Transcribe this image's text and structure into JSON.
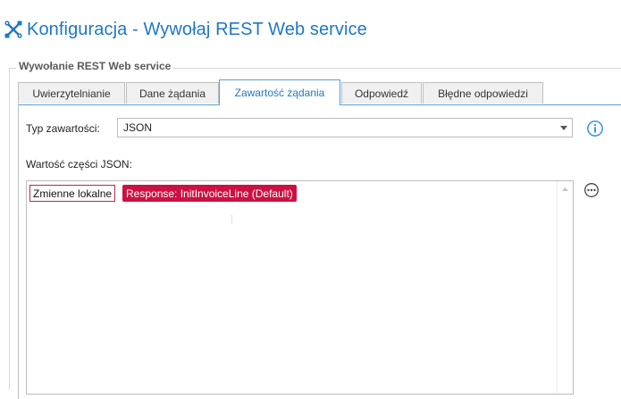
{
  "window": {
    "title": "Konfiguracja - Wywołaj REST Web service",
    "icon": "tools-cross-icon",
    "accent_color": "#1e78c2"
  },
  "group": {
    "label": "Wywołanie REST Web service"
  },
  "tabs": [
    {
      "label": "Uwierzytelnianie",
      "active": false
    },
    {
      "label": "Dane żądania",
      "active": false
    },
    {
      "label": "Zawartość żądania",
      "active": true
    },
    {
      "label": "Odpowiedź",
      "active": false
    },
    {
      "label": "Błędne odpowiedzi",
      "active": false
    }
  ],
  "content_type": {
    "label": "Typ zawartości:",
    "value": "JSON",
    "info_icon": "info-icon"
  },
  "json_value": {
    "label": "Wartość części JSON:",
    "local_vars_label": "Zmienne lokalne",
    "variable_token": "Response: InitInvoiceLine (Default)",
    "token_color": "#cc1142",
    "more_icon": "ellipsis-circle-icon"
  }
}
